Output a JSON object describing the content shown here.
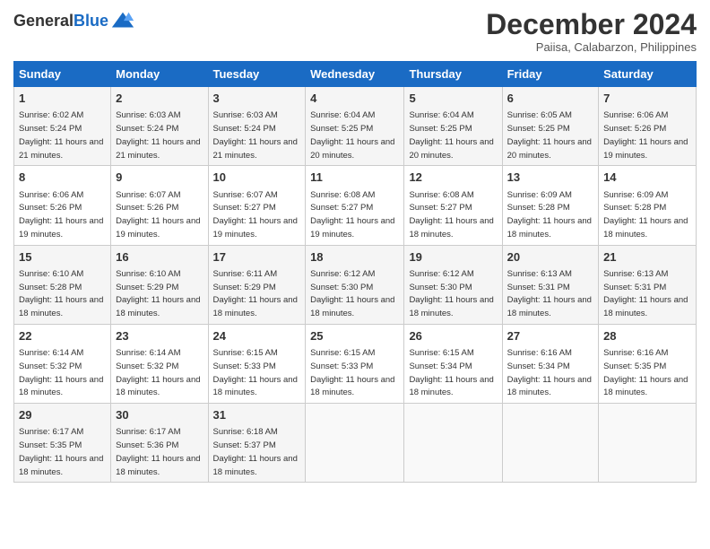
{
  "header": {
    "logo_general": "General",
    "logo_blue": "Blue",
    "month_title": "December 2024",
    "location": "Paiisa, Calabarzon, Philippines"
  },
  "weekdays": [
    "Sunday",
    "Monday",
    "Tuesday",
    "Wednesday",
    "Thursday",
    "Friday",
    "Saturday"
  ],
  "weeks": [
    [
      {
        "day": "1",
        "sunrise": "6:02 AM",
        "sunset": "5:24 PM",
        "daylight": "11 hours and 21 minutes."
      },
      {
        "day": "2",
        "sunrise": "6:03 AM",
        "sunset": "5:24 PM",
        "daylight": "11 hours and 21 minutes."
      },
      {
        "day": "3",
        "sunrise": "6:03 AM",
        "sunset": "5:24 PM",
        "daylight": "11 hours and 21 minutes."
      },
      {
        "day": "4",
        "sunrise": "6:04 AM",
        "sunset": "5:25 PM",
        "daylight": "11 hours and 20 minutes."
      },
      {
        "day": "5",
        "sunrise": "6:04 AM",
        "sunset": "5:25 PM",
        "daylight": "11 hours and 20 minutes."
      },
      {
        "day": "6",
        "sunrise": "6:05 AM",
        "sunset": "5:25 PM",
        "daylight": "11 hours and 20 minutes."
      },
      {
        "day": "7",
        "sunrise": "6:06 AM",
        "sunset": "5:26 PM",
        "daylight": "11 hours and 19 minutes."
      }
    ],
    [
      {
        "day": "8",
        "sunrise": "6:06 AM",
        "sunset": "5:26 PM",
        "daylight": "11 hours and 19 minutes."
      },
      {
        "day": "9",
        "sunrise": "6:07 AM",
        "sunset": "5:26 PM",
        "daylight": "11 hours and 19 minutes."
      },
      {
        "day": "10",
        "sunrise": "6:07 AM",
        "sunset": "5:27 PM",
        "daylight": "11 hours and 19 minutes."
      },
      {
        "day": "11",
        "sunrise": "6:08 AM",
        "sunset": "5:27 PM",
        "daylight": "11 hours and 19 minutes."
      },
      {
        "day": "12",
        "sunrise": "6:08 AM",
        "sunset": "5:27 PM",
        "daylight": "11 hours and 18 minutes."
      },
      {
        "day": "13",
        "sunrise": "6:09 AM",
        "sunset": "5:28 PM",
        "daylight": "11 hours and 18 minutes."
      },
      {
        "day": "14",
        "sunrise": "6:09 AM",
        "sunset": "5:28 PM",
        "daylight": "11 hours and 18 minutes."
      }
    ],
    [
      {
        "day": "15",
        "sunrise": "6:10 AM",
        "sunset": "5:28 PM",
        "daylight": "11 hours and 18 minutes."
      },
      {
        "day": "16",
        "sunrise": "6:10 AM",
        "sunset": "5:29 PM",
        "daylight": "11 hours and 18 minutes."
      },
      {
        "day": "17",
        "sunrise": "6:11 AM",
        "sunset": "5:29 PM",
        "daylight": "11 hours and 18 minutes."
      },
      {
        "day": "18",
        "sunrise": "6:12 AM",
        "sunset": "5:30 PM",
        "daylight": "11 hours and 18 minutes."
      },
      {
        "day": "19",
        "sunrise": "6:12 AM",
        "sunset": "5:30 PM",
        "daylight": "11 hours and 18 minutes."
      },
      {
        "day": "20",
        "sunrise": "6:13 AM",
        "sunset": "5:31 PM",
        "daylight": "11 hours and 18 minutes."
      },
      {
        "day": "21",
        "sunrise": "6:13 AM",
        "sunset": "5:31 PM",
        "daylight": "11 hours and 18 minutes."
      }
    ],
    [
      {
        "day": "22",
        "sunrise": "6:14 AM",
        "sunset": "5:32 PM",
        "daylight": "11 hours and 18 minutes."
      },
      {
        "day": "23",
        "sunrise": "6:14 AM",
        "sunset": "5:32 PM",
        "daylight": "11 hours and 18 minutes."
      },
      {
        "day": "24",
        "sunrise": "6:15 AM",
        "sunset": "5:33 PM",
        "daylight": "11 hours and 18 minutes."
      },
      {
        "day": "25",
        "sunrise": "6:15 AM",
        "sunset": "5:33 PM",
        "daylight": "11 hours and 18 minutes."
      },
      {
        "day": "26",
        "sunrise": "6:15 AM",
        "sunset": "5:34 PM",
        "daylight": "11 hours and 18 minutes."
      },
      {
        "day": "27",
        "sunrise": "6:16 AM",
        "sunset": "5:34 PM",
        "daylight": "11 hours and 18 minutes."
      },
      {
        "day": "28",
        "sunrise": "6:16 AM",
        "sunset": "5:35 PM",
        "daylight": "11 hours and 18 minutes."
      }
    ],
    [
      {
        "day": "29",
        "sunrise": "6:17 AM",
        "sunset": "5:35 PM",
        "daylight": "11 hours and 18 minutes."
      },
      {
        "day": "30",
        "sunrise": "6:17 AM",
        "sunset": "5:36 PM",
        "daylight": "11 hours and 18 minutes."
      },
      {
        "day": "31",
        "sunrise": "6:18 AM",
        "sunset": "5:37 PM",
        "daylight": "11 hours and 18 minutes."
      },
      null,
      null,
      null,
      null
    ]
  ]
}
